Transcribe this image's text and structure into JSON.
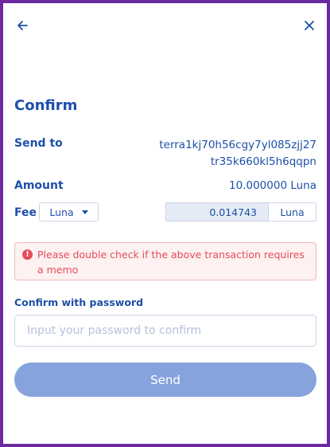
{
  "header": {
    "back_icon": "arrow-left-icon",
    "close_icon": "close-icon"
  },
  "title": "Confirm",
  "send_to": {
    "label": "Send to",
    "address": "terra1kj70h56cgy7yl085zjj27tr35k660kl5h6qqpn"
  },
  "amount": {
    "label": "Amount",
    "value": "10.000000 Luna"
  },
  "fee": {
    "label": "Fee",
    "denom_selected": "Luna",
    "amount": "0.014743",
    "unit": "Luna"
  },
  "warning": {
    "icon": "alert-circle-icon",
    "text": "Please double check if the above transaction requires a memo"
  },
  "password": {
    "label": "Confirm with password",
    "placeholder": "Input your password to confirm"
  },
  "submit": {
    "label": "Send"
  },
  "colors": {
    "primary": "#1d4fa8",
    "button": "#86a3dd",
    "warning": "#e64c57",
    "frame": "#6b2a9e"
  }
}
